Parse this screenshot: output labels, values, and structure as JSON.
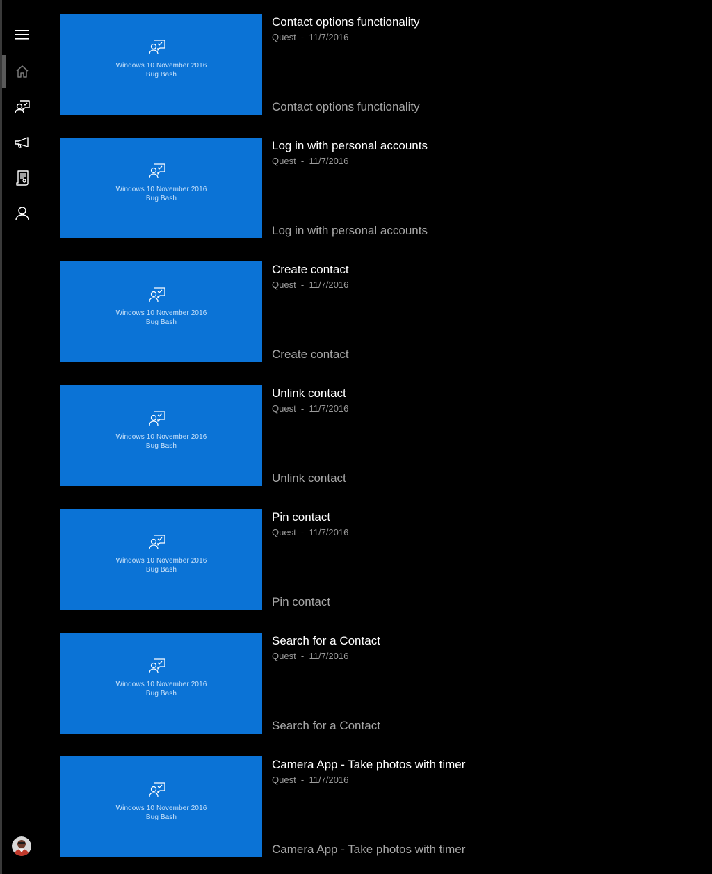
{
  "colors": {
    "background": "#000000",
    "tile_blue": "#0b73d6",
    "title_text": "#ffffff",
    "secondary_text": "#a6a6a6"
  },
  "sidebar": {
    "items": [
      {
        "name": "menu",
        "icon": "hamburger-menu-icon"
      },
      {
        "name": "home",
        "icon": "home-icon",
        "active": true
      },
      {
        "name": "quests",
        "icon": "quest-feedback-icon"
      },
      {
        "name": "announcements",
        "icon": "megaphone-icon"
      },
      {
        "name": "achievements",
        "icon": "document-badge-icon"
      },
      {
        "name": "profile",
        "icon": "person-icon"
      }
    ],
    "avatar_icon": "user-avatar"
  },
  "tile": {
    "line1": "Windows 10 November 2016",
    "line2": "Bug Bash",
    "icon": "quest-feedback-icon"
  },
  "quests": [
    {
      "title": "Contact options functionality",
      "meta": "Quest  -  11/7/2016",
      "description": "Contact options functionality"
    },
    {
      "title": "Log in with personal accounts",
      "meta": "Quest  -  11/7/2016",
      "description": "Log in with personal accounts"
    },
    {
      "title": "Create contact",
      "meta": "Quest  -  11/7/2016",
      "description": "Create contact"
    },
    {
      "title": "Unlink contact",
      "meta": "Quest  -  11/7/2016",
      "description": "Unlink contact"
    },
    {
      "title": "Pin contact",
      "meta": "Quest  -  11/7/2016",
      "description": "Pin contact"
    },
    {
      "title": "Search for a Contact",
      "meta": "Quest  -  11/7/2016",
      "description": "Search for a Contact"
    },
    {
      "title": "Camera App - Take photos with timer",
      "meta": "Quest  -  11/7/2016",
      "description": "Camera App - Take photos with timer"
    }
  ]
}
